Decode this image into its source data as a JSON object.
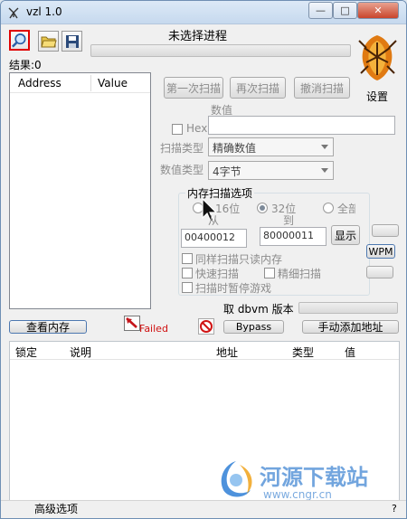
{
  "window": {
    "title": "vzl 1.0",
    "controls": [
      "—",
      "□",
      "✕"
    ]
  },
  "toolbar": {
    "process_status": "未选择进程",
    "results_label": "结果:0",
    "settings_label": "设置"
  },
  "results_list": {
    "columns": [
      "Address",
      "Value"
    ]
  },
  "scan_buttons": {
    "first_scan": "第一次扫描",
    "next_scan": "再次扫描",
    "undo_scan": "撤消扫描"
  },
  "value_section": {
    "value_label": "数值",
    "hex_label": "Hex",
    "value_input": "",
    "scan_type_label": "扫描类型",
    "scan_type_value": "精确数值",
    "value_type_label": "数值类型",
    "value_type_value": "4字节"
  },
  "memory_options": {
    "group_title": "内存扫描选项",
    "radio_16bit": "16位",
    "radio_32bit": "32位",
    "radio_all": "全部",
    "from_label": "从",
    "to_label": "到",
    "from_value": "00400012",
    "to_value": "80000011",
    "show_button": "显示",
    "cb_readonly": "同样扫描只读内存",
    "cb_fast": "快速扫描",
    "cb_fine": "精细扫描",
    "cb_pause": "扫描时暂停游戏"
  },
  "side_buttons": {
    "wpm": "WPM"
  },
  "bottom_bar": {
    "dbvm_label": "取 dbvm 版本",
    "view_memory": "查看内存",
    "failed_label": "Failed",
    "bypass": "Bypass",
    "add_address": "手动添加地址"
  },
  "address_table": {
    "columns": [
      "锁定",
      "说明",
      "地址",
      "类型",
      "值"
    ]
  },
  "footer": {
    "advanced": "高级选项",
    "help": "?"
  },
  "watermark": {
    "text": "河源下载站",
    "url": "www.cngr.cn"
  }
}
